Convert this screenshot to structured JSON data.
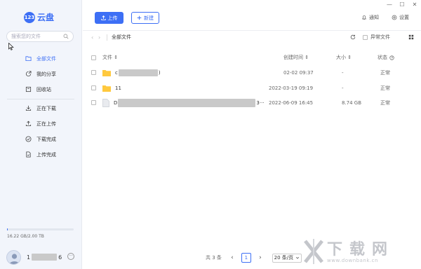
{
  "window": {
    "controls": [
      "—",
      "☐",
      "✕"
    ]
  },
  "brand": {
    "badge": "123",
    "name": "云盘"
  },
  "search": {
    "placeholder": "搜索您的文件"
  },
  "nav": {
    "all_files": "全部文件",
    "my_shares": "我的分享",
    "recycle": "回收站",
    "downloading": "正在下载",
    "uploading": "正在上传",
    "download_done": "下载完成",
    "upload_done": "上传完成"
  },
  "storage": {
    "text": "16.22 GB/2.00 TB",
    "used_fraction": 0.008
  },
  "user": {
    "name_start": "1",
    "name_end": "6"
  },
  "toolbar": {
    "upload": "上传",
    "new": "新建",
    "notify": "通知",
    "settings": "设置"
  },
  "breadcrumb": {
    "current": "全部文件",
    "abnormal": "异常文件"
  },
  "table": {
    "headers": {
      "name": "文件 ⇕",
      "created": "创建时间 ⇕",
      "size": "大小 ⇕",
      "status": "状态"
    },
    "rows": [
      {
        "name_start": "c",
        "name_end": ")",
        "type": "folder",
        "created": "02-02 09:37",
        "size": "-",
        "status": "正常"
      },
      {
        "name_start": "11",
        "name_end": "",
        "type": "folder",
        "created": "2022-03-19 09:19",
        "size": "-",
        "status": "正常"
      },
      {
        "name_start": "D",
        "name_end": "3···",
        "type": "file",
        "created": "2022-06-09 16:45",
        "size": "8.74 GB",
        "status": "正常"
      }
    ]
  },
  "pagination": {
    "total": "共 3 条",
    "page": "1",
    "page_size": "20 条/页"
  },
  "watermark": {
    "big": "下载网",
    "small": "www.downbank.cn"
  },
  "colors": {
    "accent": "#3d6ff5",
    "folder": "#ffc93e",
    "sidebar_bg": "#f2f5fb"
  }
}
